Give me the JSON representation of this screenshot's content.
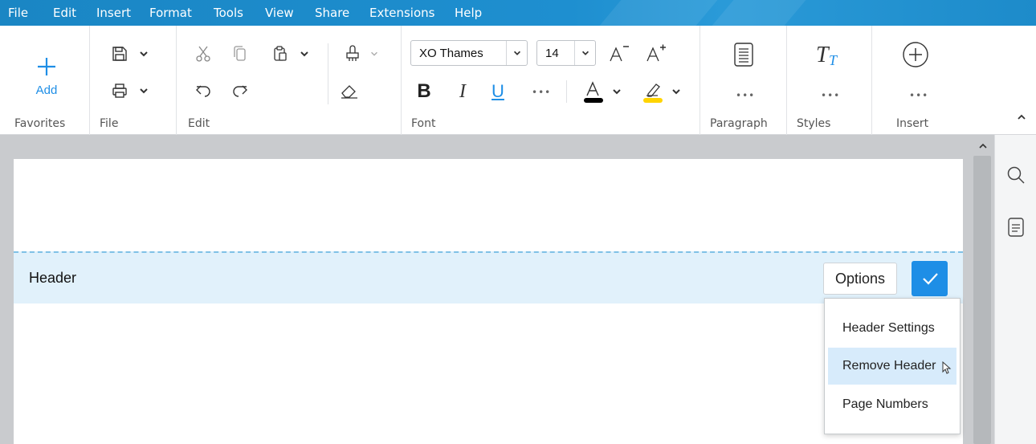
{
  "menubar": {
    "items": [
      "File",
      "Edit",
      "Insert",
      "Format",
      "Tools",
      "View",
      "Share",
      "Extensions",
      "Help"
    ]
  },
  "ribbon": {
    "groups": {
      "favorites": {
        "label": "Favorites",
        "add_label": "Add"
      },
      "file": {
        "label": "File"
      },
      "edit": {
        "label": "Edit"
      },
      "font": {
        "label": "Font",
        "font_name": "XO Thames",
        "font_size": "14",
        "bold": "B",
        "italic": "I",
        "underline": "U"
      },
      "paragraph": {
        "label": "Paragraph"
      },
      "styles": {
        "label": "Styles"
      },
      "insert": {
        "label": "Insert"
      }
    },
    "more_dots": "•••",
    "collapse_icon": "chevron-up-icon"
  },
  "document": {
    "header_label": "Header",
    "options_button": "Options"
  },
  "options_menu": {
    "items": [
      "Header Settings",
      "Remove Header",
      "Page Numbers"
    ],
    "hovered_index": 1
  },
  "colors": {
    "accent": "#1e8ee6",
    "menubar": "#1a86c4",
    "header_band": "#e1f1fb",
    "font_color_bar": "#000000",
    "highlight_bar": "#ffd400"
  }
}
